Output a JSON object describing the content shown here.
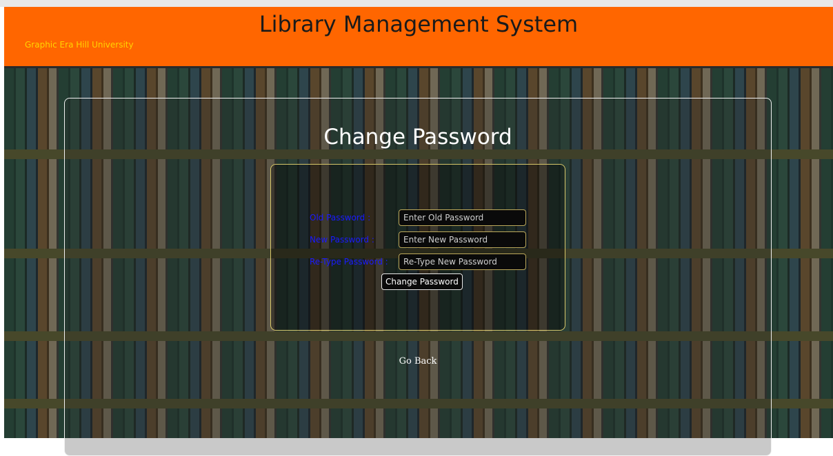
{
  "header": {
    "title": "Library Management System",
    "subtitle": "Graphic Era Hill University"
  },
  "panel": {
    "title": "Change Password",
    "fields": [
      {
        "label": "Old Password :",
        "placeholder": "Enter Old Password",
        "value": ""
      },
      {
        "label": "New Password :",
        "placeholder": "Enter New Password",
        "value": ""
      },
      {
        "label": "Re-Type Password :",
        "placeholder": "Re-Type New Password",
        "value": ""
      }
    ],
    "submit_label": "Change Password",
    "back_link": "Go Back"
  },
  "colors": {
    "header_bg": "#ff6600",
    "subtitle_text": "#ffd400",
    "label_text": "#1a1aff",
    "field_border": "#bda95a"
  }
}
